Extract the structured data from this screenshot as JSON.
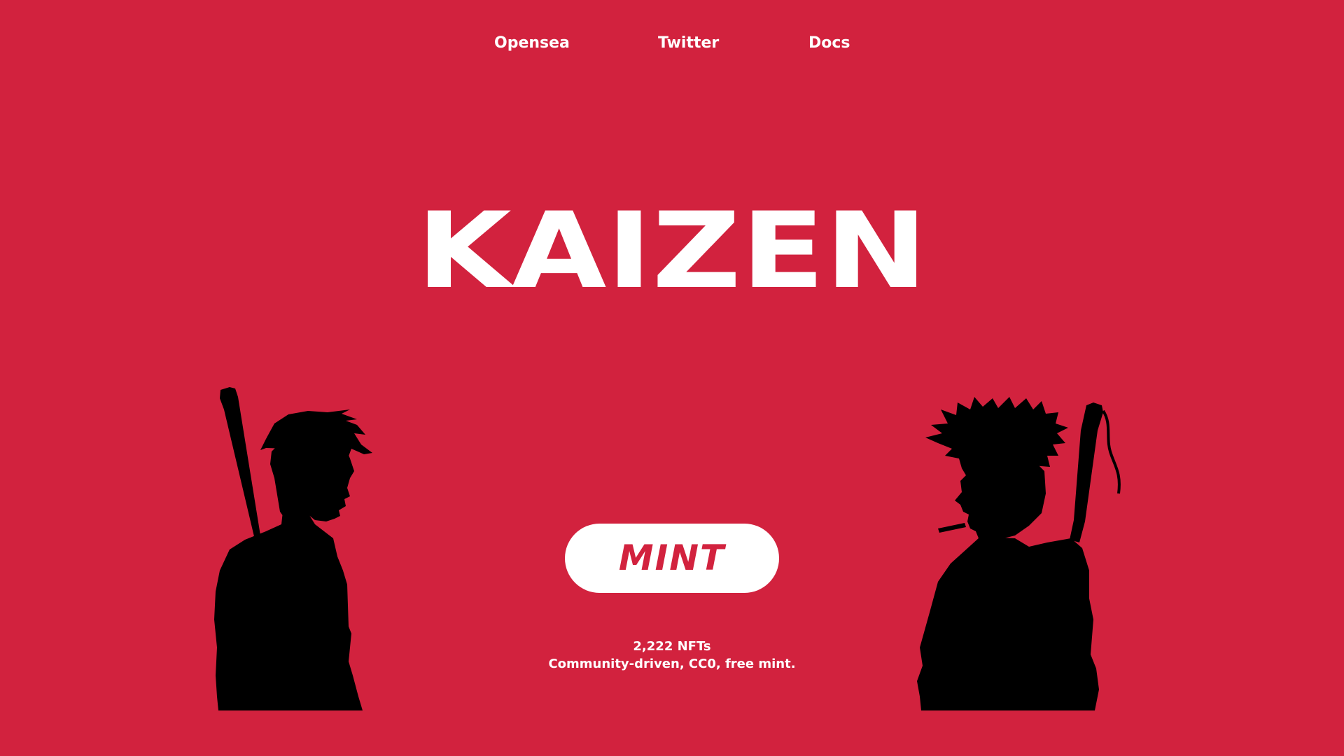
{
  "nav": {
    "items": [
      {
        "label": "Opensea"
      },
      {
        "label": "Twitter"
      },
      {
        "label": "Docs"
      }
    ]
  },
  "hero": {
    "title": "KAIZEN",
    "mint_label": "MINT",
    "supply_text": "2,222 NFTs",
    "tagline": "Community-driven, CC0, free mint."
  },
  "colors": {
    "background": "#d2223e",
    "text": "#ffffff",
    "silhouette": "#000000"
  }
}
